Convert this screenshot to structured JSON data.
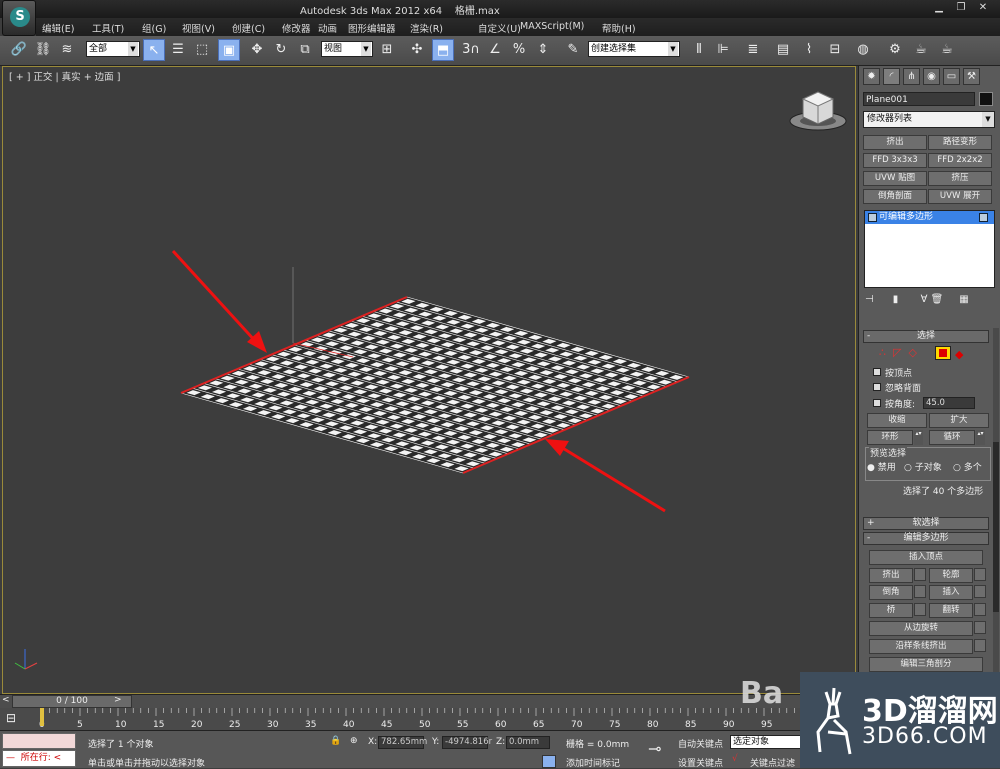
{
  "title": {
    "app": "Autodesk 3ds Max  2012 x64",
    "file": "格栅.max"
  },
  "menu": [
    "编辑(E)",
    "工具(T)",
    "组(G)",
    "视图(V)",
    "创建(C)",
    "修改器",
    "动画",
    "图形编辑器",
    "渲染(R)",
    "自定义(U)",
    "MAXScript(M)",
    "帮助(H)"
  ],
  "toolbar": {
    "filter_dropdown": "全部",
    "refcoord_dropdown": "视图",
    "named_selection": "创建选择集",
    "snap_value": "3"
  },
  "viewport": {
    "label": "[ + ] 正交 | 真实 + 边面 ]",
    "grid_cells_u": 20,
    "grid_cells_v": 20
  },
  "panel": {
    "object_name": "Plane001",
    "modifier_list": "修改器列表",
    "modifier_buttons": [
      [
        "挤出",
        "路径变形"
      ],
      [
        "FFD 3x3x3",
        "FFD 2x2x2"
      ],
      [
        "UVW 贴图",
        "挤压"
      ],
      [
        "倒角剖面",
        "UVW 展开"
      ]
    ],
    "stack_item": "可编辑多边形",
    "selection": {
      "header": "选择",
      "by_vertex": "按顶点",
      "ignore_backfacing": "忽略背面",
      "by_angle": "按角度:",
      "angle_value": "45.0",
      "shrink": "收缩",
      "grow": "扩大",
      "ring": "环形",
      "loop": "循环",
      "preview_label": "预览选择",
      "preview_options": [
        "禁用",
        "子对象",
        "多个"
      ],
      "status": "选择了 40 个多边形"
    },
    "soft_selection": "软选择",
    "edit_poly": {
      "header": "编辑多边形",
      "insert_vertex": "插入顶点",
      "extrude": "挤出",
      "outline": "轮廓",
      "bevel": "倒角",
      "inset": "插入",
      "bridge": "桥",
      "flip": "翻转",
      "hinge": "从边旋转",
      "extrude_spline": "沿样条线挤出",
      "edit_tri": "编辑三角剖分"
    }
  },
  "timeline": {
    "slider": "0 / 100",
    "ticks": [
      "0",
      "5",
      "10",
      "15",
      "20",
      "25",
      "30",
      "35",
      "40",
      "45",
      "50",
      "55",
      "60",
      "65",
      "70",
      "75",
      "80",
      "85",
      "90",
      "95"
    ]
  },
  "status": {
    "script_run": "所在行:",
    "selected": "选择了 1 个对象",
    "prompt": "单击或单击并拖动以选择对象",
    "x_label": "X:",
    "x_value": "782.65mm",
    "y_label": "Y:",
    "y_value": "-4974.816r",
    "z_label": "Z:",
    "z_value": "0.0mm",
    "grid": "栅格 = 0.0mm",
    "add_time_tag": "添加时间标记",
    "auto_key": "自动关键点",
    "set_key": "设置关键点",
    "key_dropdown": "选定对象",
    "key_filter": "关键点过滤"
  },
  "watermark": {
    "brand": "3D溜溜网",
    "domain": "3D66.COM",
    "bai": "Ba"
  },
  "colors": {
    "accent": "#3a82e6",
    "annotation_arrow": "#ee1111",
    "selected_edge": "#dd2222"
  }
}
